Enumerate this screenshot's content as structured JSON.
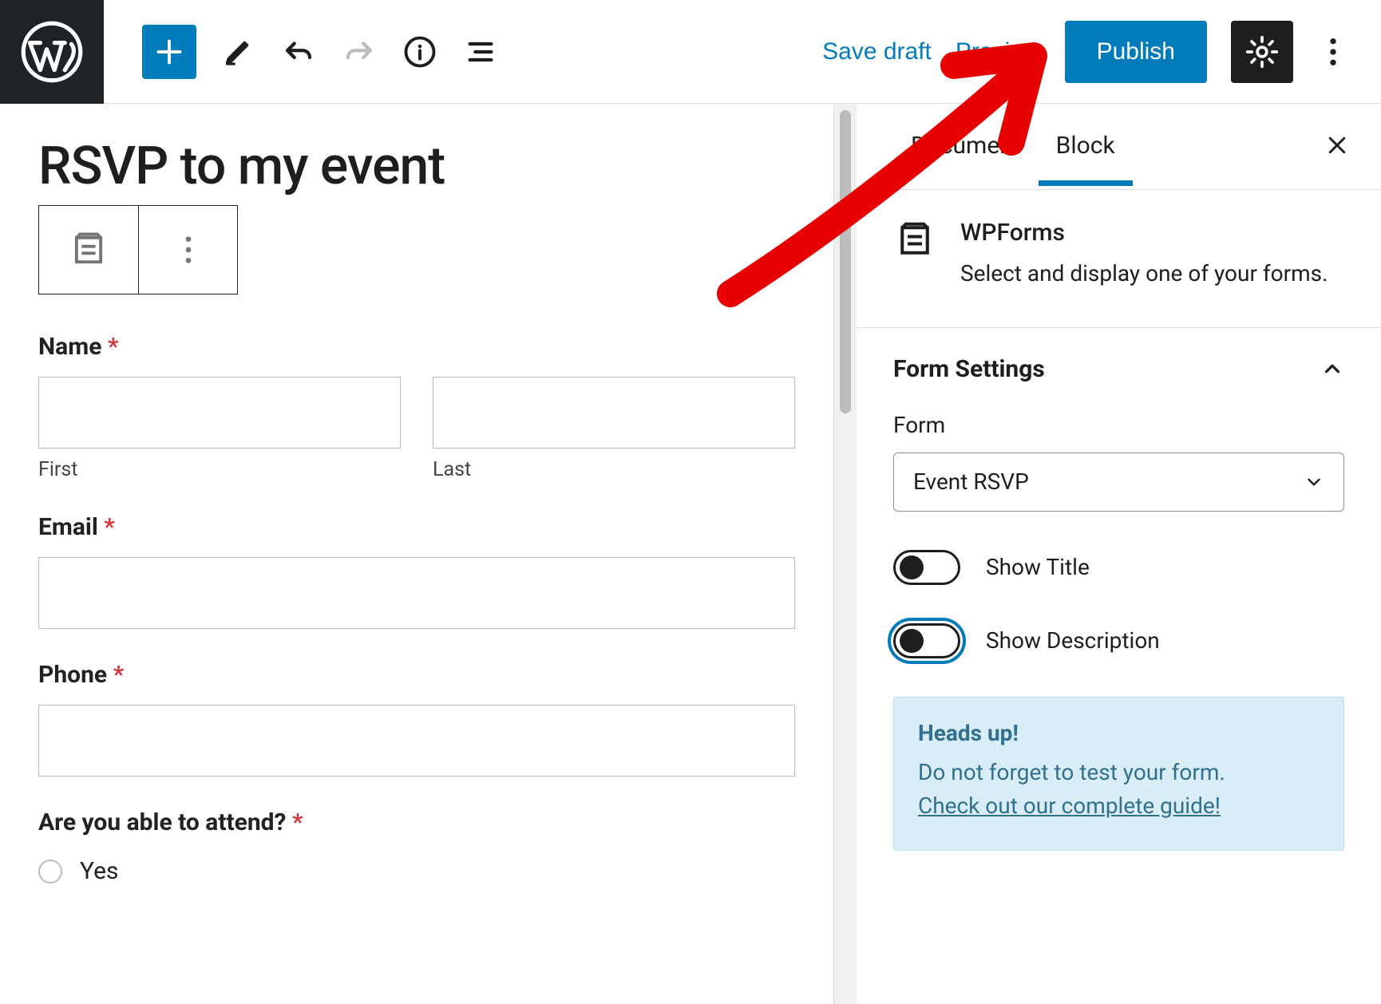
{
  "toolbar": {
    "save_draft": "Save draft",
    "preview": "Preview",
    "publish": "Publish"
  },
  "post": {
    "title": "RSVP to my event"
  },
  "form": {
    "name_label": "Name",
    "first_sub": "First",
    "last_sub": "Last",
    "email_label": "Email",
    "phone_label": "Phone",
    "attend_label": "Are you able to attend?",
    "attend_opt1": "Yes"
  },
  "sidebar": {
    "tab_document": "Document",
    "tab_block": "Block",
    "block_name": "WPForms",
    "block_desc": "Select and display one of your forms.",
    "section_title": "Form Settings",
    "form_label": "Form",
    "form_select_value": "Event RSVP",
    "toggle_title": "Show Title",
    "toggle_desc": "Show Description",
    "notice_title": "Heads up!",
    "notice_text": "Do not forget to test your form.",
    "notice_link": "Check out our complete guide!"
  }
}
